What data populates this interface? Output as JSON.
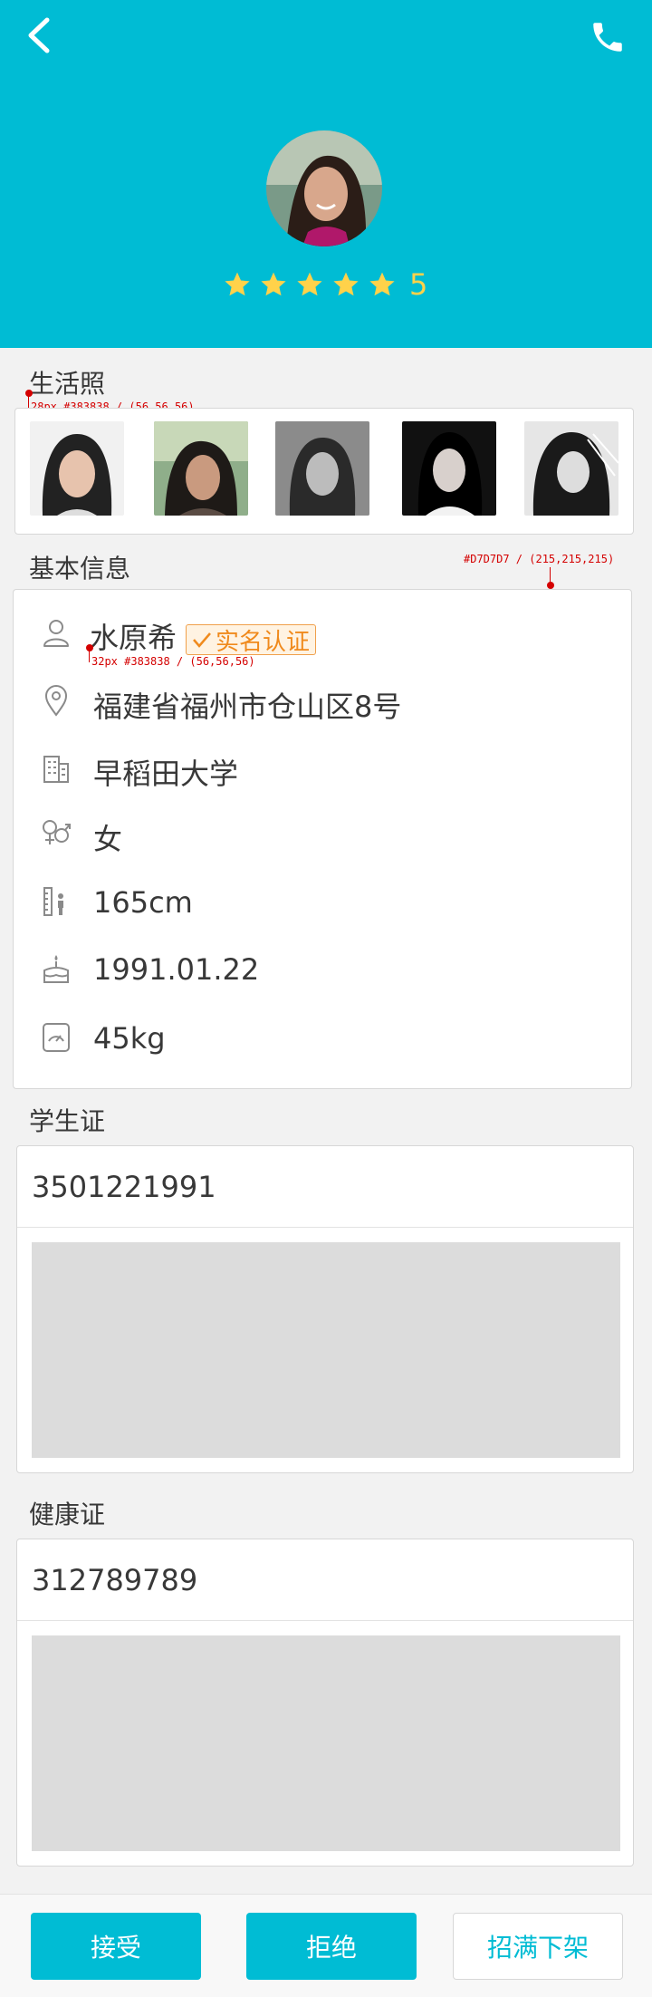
{
  "header": {
    "rating": "5",
    "star_count": 5,
    "colors": {
      "background": "#00bcd4",
      "star": "#ffd24a"
    },
    "icons": {
      "back": "back-arrow-icon",
      "call": "phone-icon"
    }
  },
  "life_photos": {
    "title": "生活照",
    "count": 5,
    "annotation": "28px #383838 / (56,56,56)"
  },
  "basic_info": {
    "title": "基本信息",
    "annotation_border": "#D7D7D7 / (215,215,215)",
    "annotation_text": "32px #383838 / (56,56,56)",
    "name": "水原希",
    "verified_label": "实名认证",
    "address": "福建省福州市仓山区8号",
    "school": "早稻田大学",
    "gender": "女",
    "height": "165cm",
    "birthday": "1991.01.22",
    "weight": "45kg"
  },
  "student_card": {
    "title": "学生证",
    "number": "3501221991"
  },
  "health_card": {
    "title": "健康证",
    "number": "312789789"
  },
  "actions": {
    "accept": "接受",
    "reject": "拒绝",
    "full_unlist": "招满下架"
  }
}
